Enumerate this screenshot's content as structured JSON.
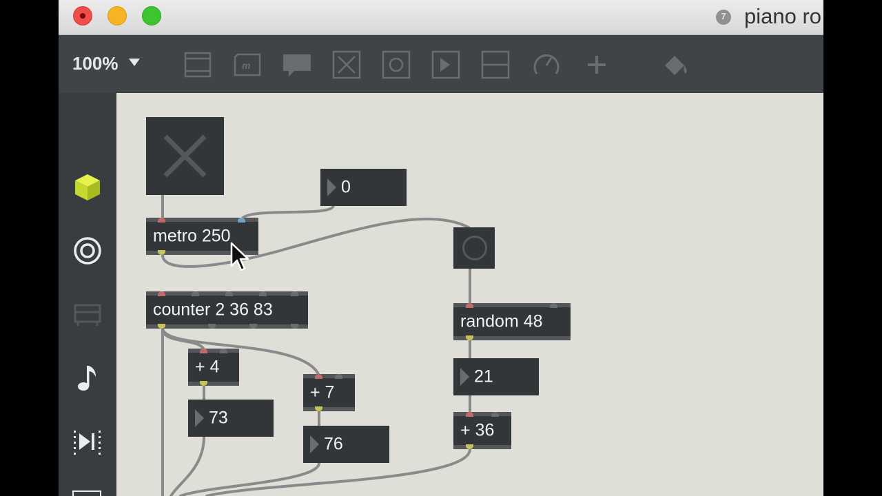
{
  "window": {
    "title": "piano ro"
  },
  "toolbar": {
    "zoom": "100%"
  },
  "toolbar_icons": [
    "presentation-icon",
    "message-icon",
    "comment-icon",
    "toggle-icon",
    "button-icon",
    "number-icon",
    "slider-icon",
    "dial-icon",
    "plus-icon",
    "paint-bucket-icon"
  ],
  "sidebar_icons": [
    "package-icon",
    "target-icon",
    "inspector-icon",
    "music-note-icon",
    "playback-icon"
  ],
  "objects": {
    "metro": "metro 250",
    "counter": "counter 2 36 83",
    "random": "random 48",
    "plus4": "+ 4",
    "plus7": "+ 7",
    "plus36": "+ 36"
  },
  "numbers": {
    "n0": "0",
    "n73": "73",
    "n76": "76",
    "n21": "21"
  },
  "colors": {
    "toolbar_bg": "#414447",
    "canvas_bg": "#dfdfd7",
    "object_bg": "#333638",
    "accent_package": "#d6e83a"
  }
}
